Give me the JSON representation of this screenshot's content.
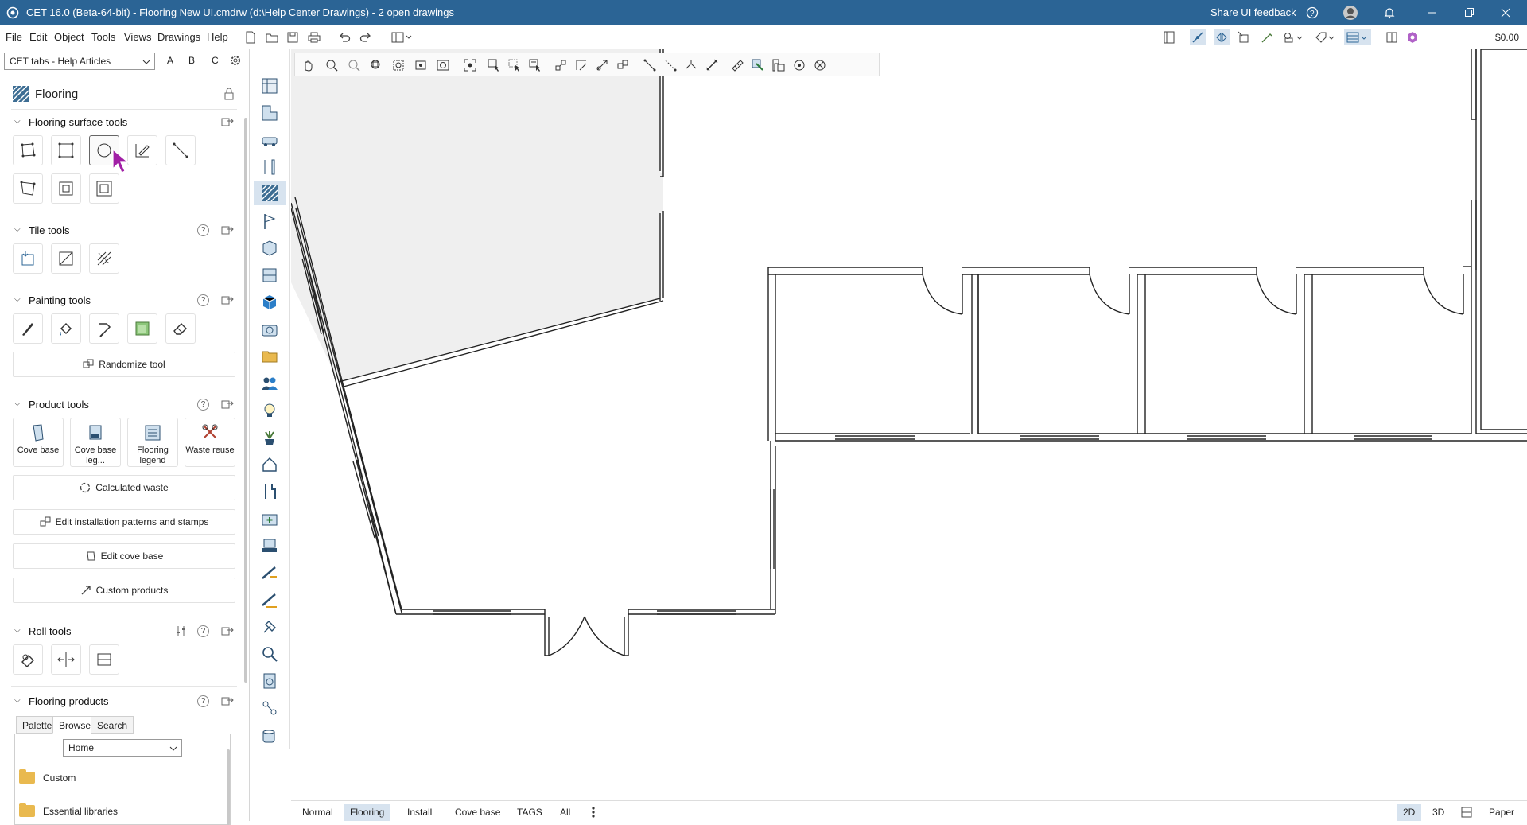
{
  "titlebar": {
    "title": "CET 16.0 (Beta-64-bit) - Flooring New UI.cmdrw (d:\\Help Center Drawings) - 2  open drawings",
    "feedback": "Share UI feedback"
  },
  "menu": {
    "items": [
      "File",
      "Edit",
      "Object",
      "Tools",
      "Views",
      "Drawings",
      "Help"
    ],
    "cost": "$0.00"
  },
  "panel": {
    "tabs_select": "CET tabs - Help Articles",
    "abc": [
      "A",
      "B",
      "C"
    ],
    "extension_title": "Flooring",
    "surface_tools": "Flooring surface tools",
    "tile_tools": "Tile tools",
    "painting_tools": "Painting tools",
    "randomize": "Randomize tool",
    "product_tools": "Product tools",
    "products": [
      {
        "label": "Cove base"
      },
      {
        "label": "Cove base leg..."
      },
      {
        "label": "Flooring legend"
      },
      {
        "label": "Waste reuse"
      }
    ],
    "calculated_waste": "Calculated waste",
    "edit_patterns": "Edit installation patterns and stamps",
    "edit_cove": "Edit cove base",
    "custom_products": "Custom products",
    "roll_tools": "Roll tools",
    "flooring_products": "Flooring products",
    "product_tabs": [
      "Palette",
      "Browse",
      "Search"
    ],
    "browse_select": "Home",
    "library": [
      "Custom",
      "Essential libraries"
    ]
  },
  "bottom": {
    "tabs": [
      "Normal",
      "Flooring",
      "Install",
      "Cove base",
      "TAGS",
      "All"
    ],
    "active_tab": "Flooring",
    "views": [
      "2D",
      "3D",
      "Paper"
    ]
  }
}
